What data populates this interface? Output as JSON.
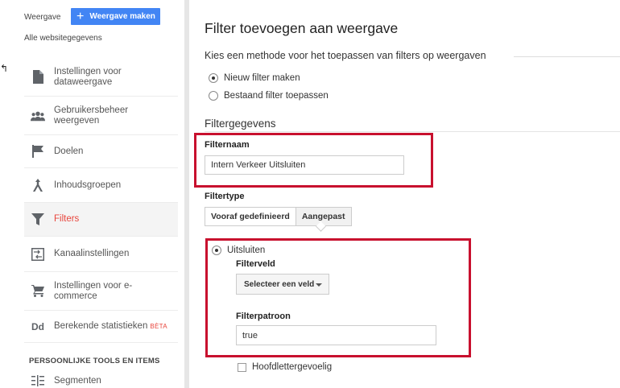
{
  "sidebar": {
    "view_label": "Weergave",
    "create_view_label": "Weergave maken",
    "view_name": "Alle websitegegevens",
    "items": [
      {
        "label": "Instellingen voor dataweergave",
        "icon": "document-icon"
      },
      {
        "label": "Gebruikersbeheer weergeven",
        "icon": "users-icon"
      },
      {
        "label": "Doelen",
        "icon": "flag-icon"
      },
      {
        "label": "Inhoudsgroepen",
        "icon": "content-group-icon"
      },
      {
        "label": "Filters",
        "icon": "filter-icon",
        "active": true
      },
      {
        "label": "Kanaalinstellingen",
        "icon": "channel-icon"
      },
      {
        "label": "Instellingen voor e-commerce",
        "icon": "cart-icon"
      },
      {
        "label": "Berekende statistieken",
        "badge": "BÈTA",
        "icon": "dd-icon"
      }
    ],
    "section_title": "PERSOONLIJKE TOOLS EN ITEMS",
    "segments_label": "Segmenten"
  },
  "main": {
    "title": "Filter toevoegen aan weergave",
    "method_prompt": "Kies een methode voor het toepassen van filters op weergaven",
    "method_options": [
      {
        "label": "Nieuw filter maken",
        "checked": true
      },
      {
        "label": "Bestaand filter toepassen",
        "checked": false
      }
    ],
    "details_heading": "Filtergegevens",
    "filter_name_label": "Filternaam",
    "filter_name_value": "Intern Verkeer Uitsluiten",
    "filter_type_label": "Filtertype",
    "type_tabs": [
      "Vooraf gedefinieerd",
      "Aangepast"
    ],
    "selected_type": "Aangepast",
    "exclude_label": "Uitsluiten",
    "filter_field_label": "Filterveld",
    "filter_field_select": "Selecteer een veld",
    "filter_pattern_label": "Filterpatroon",
    "filter_pattern_value": "true",
    "case_sensitive_label": "Hoofdlettergevoelig"
  },
  "colors": {
    "accent_blue": "#4285f4",
    "active_red": "#e8453c",
    "highlight_box": "#c8102e"
  }
}
